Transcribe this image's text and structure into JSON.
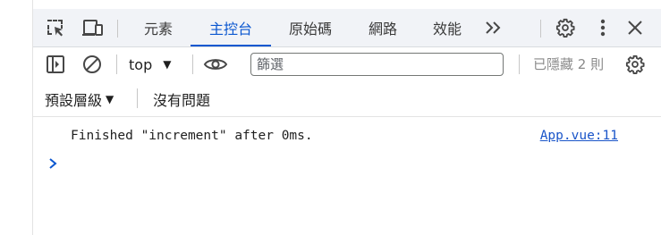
{
  "tabs": {
    "items": [
      {
        "label": "元素"
      },
      {
        "label": "主控台"
      },
      {
        "label": "原始碼"
      },
      {
        "label": "網路"
      },
      {
        "label": "效能"
      }
    ],
    "active_index": 1
  },
  "icons": {
    "inspect": "inspect-element-icon",
    "device": "device-toolbar-icon",
    "more_tabs": "chevron-double-right-icon",
    "settings": "gear-icon",
    "kebab": "kebab-menu-icon",
    "close": "close-icon",
    "sidebar": "sidebar-toggle-icon",
    "clear": "clear-console-icon",
    "eye": "eye-icon",
    "console_settings": "gear-icon",
    "prompt": "chevron-right-icon"
  },
  "toolbar": {
    "context": "top",
    "filter_placeholder": "篩選",
    "filter_value": "",
    "hidden_count": "已隱藏 2 則"
  },
  "levels": {
    "dropdown_label": "預設層級",
    "issues_label": "沒有問題"
  },
  "console": {
    "messages": [
      {
        "text": "Finished \"increment\" after 0ms.",
        "source": "App.vue:11"
      }
    ]
  },
  "colors": {
    "accent": "#0b57d0",
    "link": "#1a55c9",
    "tabbar_bg": "#f1f3f7"
  }
}
